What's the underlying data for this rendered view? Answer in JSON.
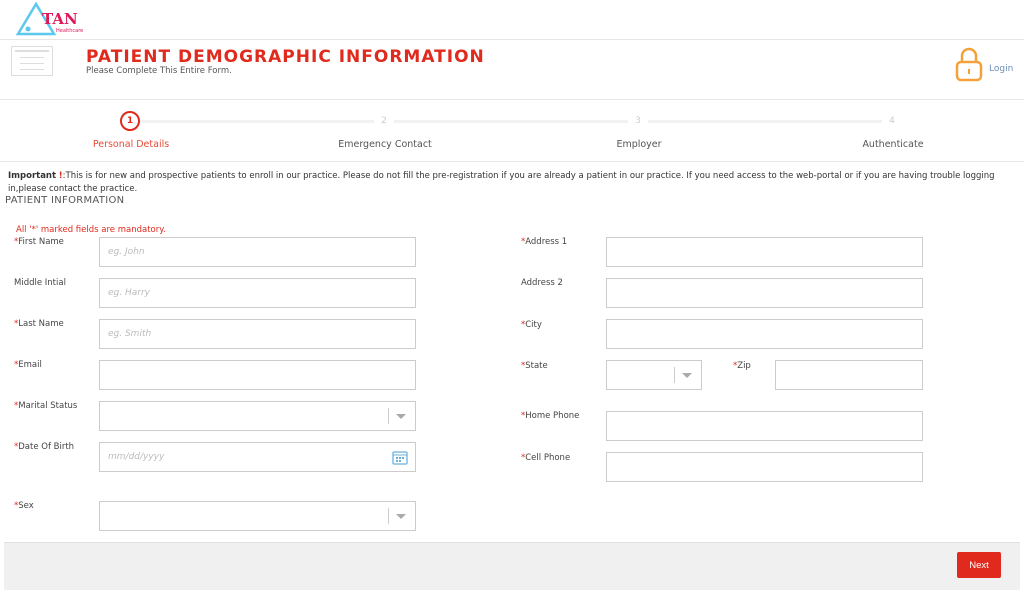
{
  "brand": {
    "logo_text": "TAN",
    "logo_sub": "Healthcare"
  },
  "header": {
    "title": "PATIENT DEMOGRAPHIC INFORMATION",
    "subtitle": "Please Complete This Entire Form.",
    "login": "Login"
  },
  "steps": [
    {
      "num": "1",
      "label": "Personal Details"
    },
    {
      "num": "2",
      "label": "Emergency Contact"
    },
    {
      "num": "3",
      "label": "Employer"
    },
    {
      "num": "4",
      "label": "Authenticate"
    }
  ],
  "notice": {
    "bold": "Important",
    "text": ":This is for new and prospective patients to enroll in our practice. Please do not fill the pre-registration if you are already a patient in our practice. If you need access to the web-portal or if you are having trouble logging in,please contact the practice."
  },
  "section": "PATIENT INFORMATION",
  "mandatory": "All '*' marked fields are mandatory.",
  "left_fields": [
    {
      "label": "First Name",
      "req": "*",
      "placeholder": "eg. John"
    },
    {
      "label": "Middle Intial",
      "req": "",
      "placeholder": "eg. Harry"
    },
    {
      "label": "Last Name",
      "req": "*",
      "placeholder": "eg. Smith"
    },
    {
      "label": "Email",
      "req": "*",
      "placeholder": ""
    },
    {
      "label": "Marital Status",
      "req": "*",
      "placeholder": ""
    },
    {
      "label": "Date Of Birth",
      "req": "*",
      "placeholder": "mm/dd/yyyy"
    },
    {
      "label": "Sex",
      "req": "*",
      "placeholder": ""
    }
  ],
  "right_fields": [
    {
      "label": "Address 1",
      "req": "*"
    },
    {
      "label": "Address 2",
      "req": ""
    },
    {
      "label": "City",
      "req": "*"
    },
    {
      "label": "State",
      "req": "*"
    },
    {
      "label": "Zip",
      "req": "*"
    },
    {
      "label": "Home Phone",
      "req": "*"
    },
    {
      "label": "Cell Phone",
      "req": "*"
    }
  ],
  "next": "Next"
}
